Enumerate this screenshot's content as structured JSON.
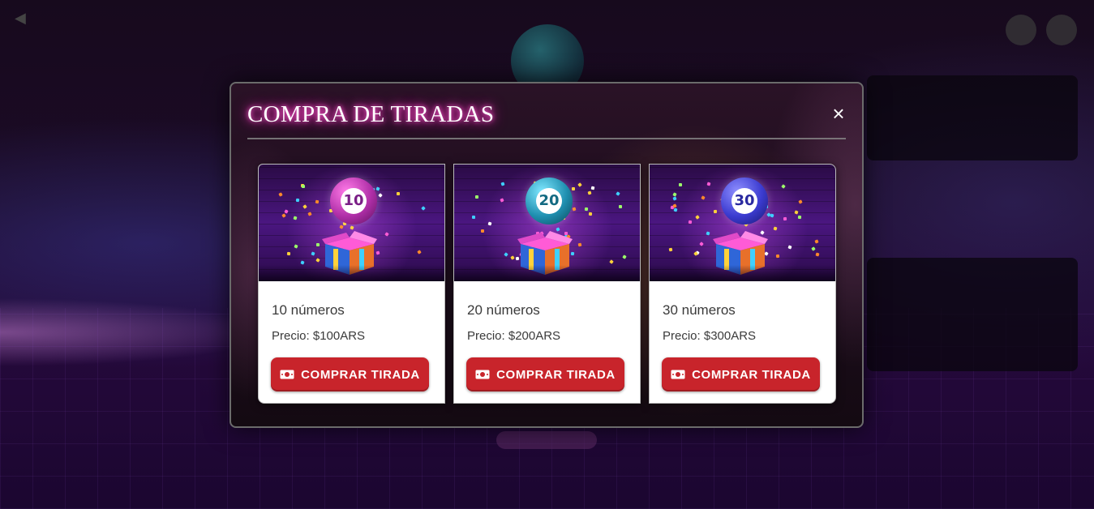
{
  "modal": {
    "title": "COMPRA DE TIRADAS",
    "close_label": "×"
  },
  "packages": [
    {
      "ball_number": "10",
      "ball_color": "#b02fa8",
      "quantity_label": "10 números",
      "price_label": "Precio: $100ARS",
      "button_label": "COMPRAR TIRADA",
      "image_icon": "gift-box-with-ball-icon"
    },
    {
      "ball_number": "20",
      "ball_color": "#1f8fb0",
      "quantity_label": "20 números",
      "price_label": "Precio: $200ARS",
      "button_label": "COMPRAR TIRADA",
      "image_icon": "gift-box-with-ball-icon"
    },
    {
      "ball_number": "30",
      "ball_color": "#3b3bd0",
      "quantity_label": "30 números",
      "price_label": "Precio: $300ARS",
      "button_label": "COMPRAR TIRADA",
      "image_icon": "gift-box-with-ball-icon"
    }
  ],
  "colors": {
    "button": "#c8242b",
    "title_glow": "#ff2fb8"
  }
}
